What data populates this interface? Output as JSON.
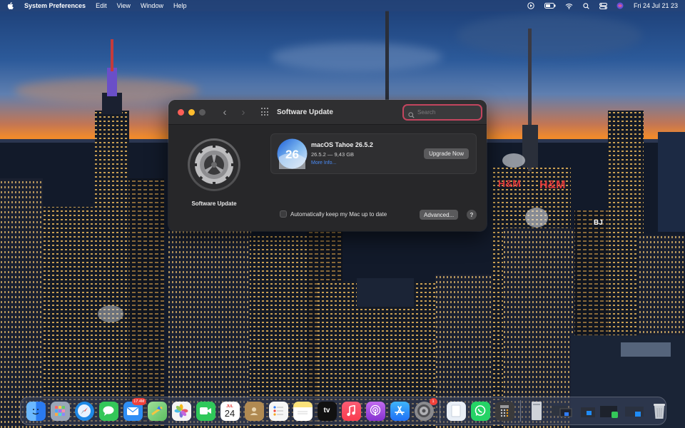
{
  "menubar": {
    "app_name": "System Preferences",
    "menus": [
      "Edit",
      "View",
      "Window",
      "Help"
    ],
    "clock": "Fri 24 Jul  21 23"
  },
  "window": {
    "title": "Software Update",
    "search_placeholder": "Search",
    "sidebar_label": "Software Update",
    "update": {
      "name": "macOS Tahoe 26.5.2",
      "version_size": "26.5.2 — 9,43 GB",
      "more_info": "More Info...",
      "icon_text": "26",
      "upgrade_label": "Upgrade Now"
    },
    "auto_update_label": "Automatically keep my Mac up to date",
    "auto_update_checked": false,
    "advanced_label": "Advanced...",
    "help_label": "?"
  },
  "dock": {
    "apps": [
      {
        "name": "finder",
        "bg": "#2a7af0"
      },
      {
        "name": "launchpad",
        "bg": "#9aa6b8"
      },
      {
        "name": "safari",
        "bg": "#1e88e5"
      },
      {
        "name": "messages",
        "bg": "#34c759"
      },
      {
        "name": "mail",
        "bg": "#2f8ef5",
        "badge": "17.4M"
      },
      {
        "name": "maps",
        "bg": "#6fcf73"
      },
      {
        "name": "photos",
        "bg": "#f4f4f4"
      },
      {
        "name": "facetime",
        "bg": "#30c85a"
      },
      {
        "name": "calendar",
        "bg": "#ffffff",
        "month": "JUL",
        "day": "24"
      },
      {
        "name": "contacts",
        "bg": "#b08a52"
      },
      {
        "name": "reminders",
        "bg": "#f6f6f6"
      },
      {
        "name": "notes",
        "bg": "#fbe27a"
      },
      {
        "name": "tv",
        "bg": "#111111",
        "label": "tv"
      },
      {
        "name": "music",
        "bg": "#fa3e55"
      },
      {
        "name": "podcasts",
        "bg": "#9b4de0"
      },
      {
        "name": "app-store",
        "bg": "#1f8bf5"
      },
      {
        "name": "system-preferences",
        "bg": "#8a8a8e",
        "badge": "1"
      },
      {
        "name": "preview",
        "bg": "#e8eef6"
      },
      {
        "name": "whatsapp",
        "bg": "#25d366"
      },
      {
        "name": "calculator",
        "bg": "#3a3a3c"
      }
    ],
    "right_items": [
      "file-stack",
      "window-thumb-1",
      "window-thumb-2",
      "window-thumb-3",
      "window-thumb-4",
      "trash"
    ]
  }
}
